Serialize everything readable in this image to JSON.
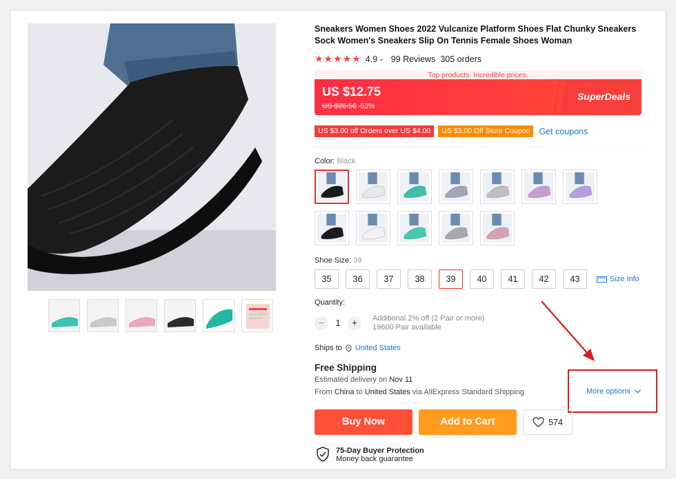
{
  "product": {
    "title": "Sneakers Women Shoes 2022 Vulcanize Platform Shoes Flat Chunky Sneakers Sock Women's Sneakers Slip On Tennis Female Shoes Woman",
    "stars": "★★★★★",
    "rating": "4.9",
    "reviews": "99 Reviews",
    "orders": "305 orders"
  },
  "promo": {
    "banner": "Top products. Incredible prices.",
    "price": "US $12.75",
    "old_price": "US $26.56",
    "discount": "-52%",
    "badge": "SuperDeals"
  },
  "coupons": {
    "items": [
      "US $3.00 off Orders over US $4.00",
      "US $3.00 Off Store Coupon"
    ],
    "get_label": "Get coupons"
  },
  "color": {
    "label": "Color:",
    "selected": "Black",
    "swatches": [
      "#1a1a1a",
      "#e8e8ea",
      "#3fbfa8",
      "#9ea7b6",
      "#bdbdc3",
      "#c79fcf",
      "#b79ee0",
      "#1b1b1b",
      "#f1f1f1",
      "#47c7b1",
      "#a9a9ad",
      "#d3a2b5"
    ]
  },
  "size": {
    "label": "Shoe Size:",
    "selected": "39",
    "options": [
      "35",
      "36",
      "37",
      "38",
      "39",
      "40",
      "41",
      "42",
      "43"
    ],
    "info_label": "Size Info"
  },
  "quantity": {
    "label": "Quantity:",
    "value": "1",
    "minus": "−",
    "plus": "+",
    "note1": "Additional 2% off (2 Pair or more)",
    "note2": "19600 Pair available"
  },
  "shipping": {
    "ships_to_label": "Ships to",
    "country": "United States",
    "title": "Free Shipping",
    "est_prefix": "Estimated delivery on",
    "est_date": "Nov 11",
    "from_label": "From",
    "from": "China",
    "to_label": "to",
    "to": "United States",
    "via": "via AliExpress Standard Shipping",
    "more_options": "More options"
  },
  "actions": {
    "buy_now": "Buy Now",
    "add_to_cart": "Add to Cart",
    "wishlist_count": "574"
  },
  "protection": {
    "title": "75-Day Buyer Protection",
    "subtitle": "Money back guarantee"
  },
  "thumbnails": [
    "#39c3b5",
    "#c9c9cc",
    "#e7a9bd",
    "#2a2a2a",
    "#22b7a3",
    "#f3d6cf"
  ]
}
